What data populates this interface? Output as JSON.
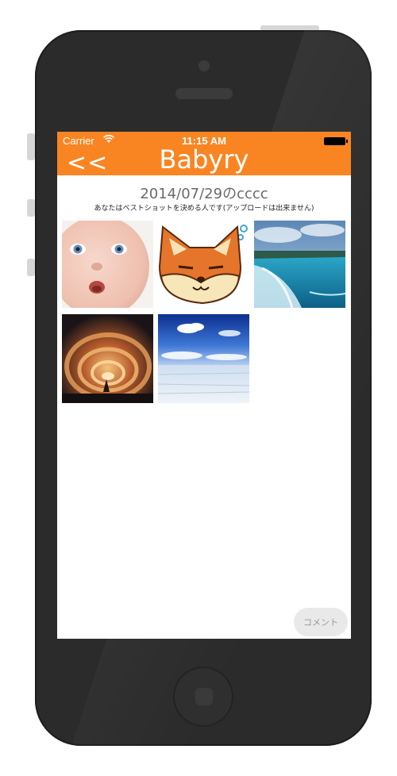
{
  "status": {
    "carrier": "Carrier",
    "time": "11:15 AM"
  },
  "nav": {
    "back_label": "<<",
    "title": "Babyry"
  },
  "content": {
    "date_title": "2014/07/29のcccc",
    "subtitle": "あなたはベストショットを決める人です(アップロードは出来ません)"
  },
  "photos": [
    {
      "subject": "baby-face"
    },
    {
      "subject": "cartoon-fox"
    },
    {
      "subject": "waterfall"
    },
    {
      "subject": "swirling-clouds"
    },
    {
      "subject": "sky-and-ice-field"
    }
  ],
  "actions": {
    "comment_label": "コメント"
  },
  "colors": {
    "navbar": "#f98522",
    "device_body": "#2b2b2b",
    "screen_bg": "#ffffff"
  }
}
